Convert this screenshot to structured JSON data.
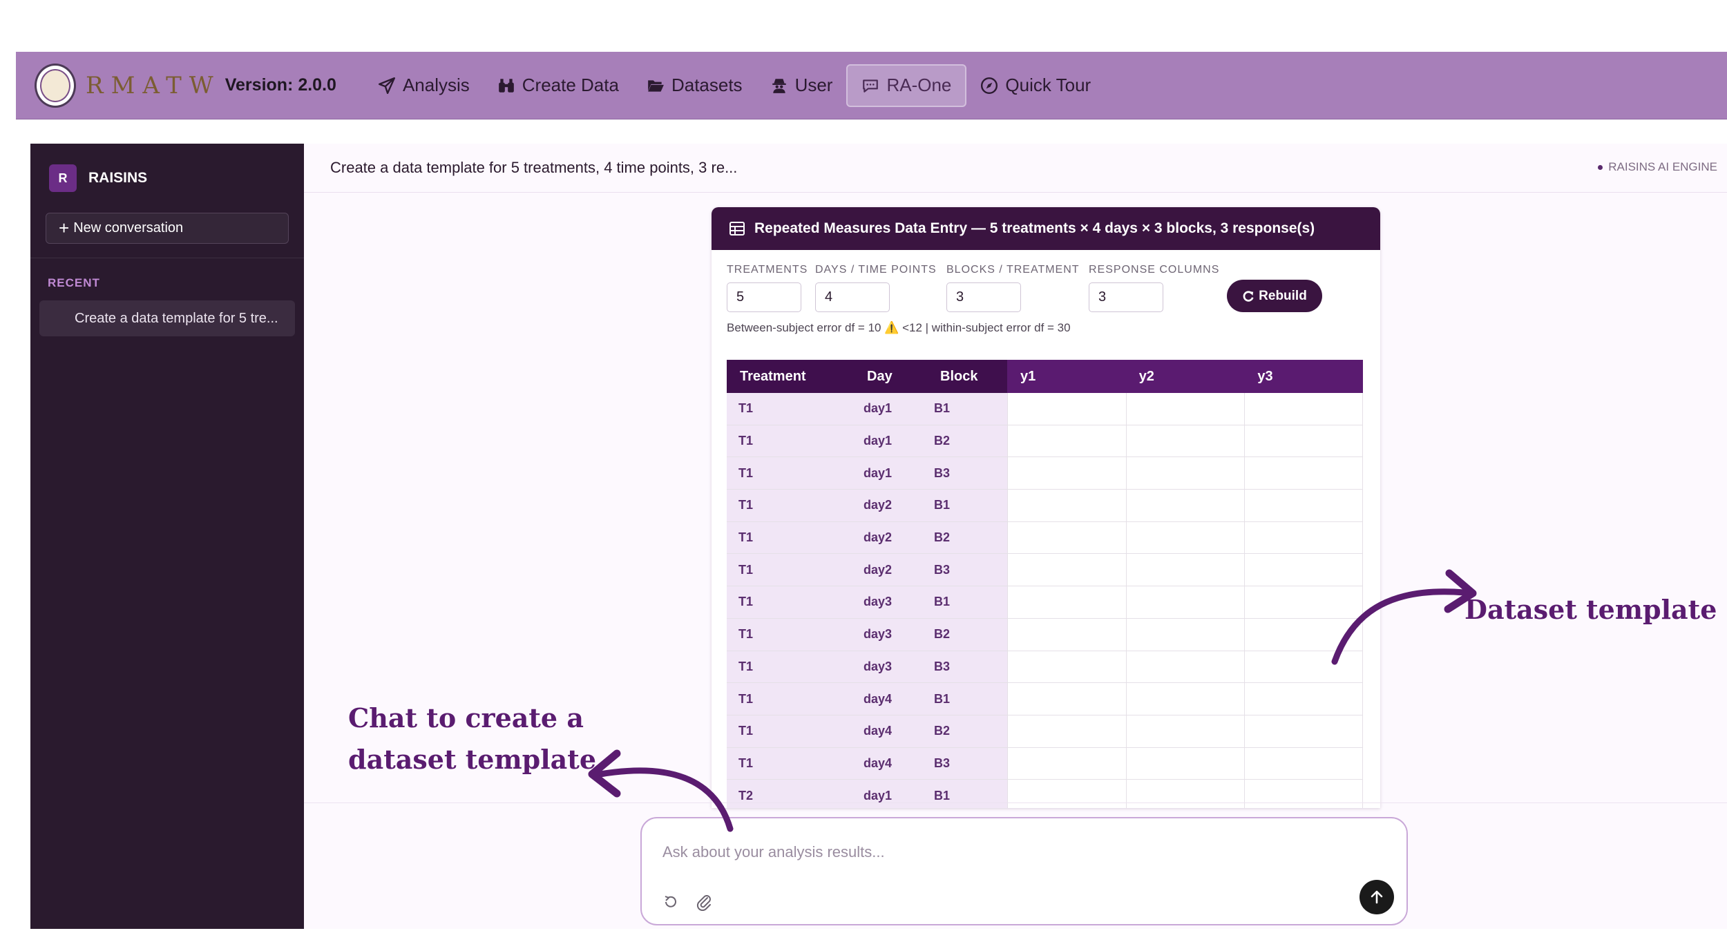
{
  "nav": {
    "brand": "RMATW",
    "version": "Version: 2.0.0",
    "items": [
      {
        "label": "Analysis",
        "icon": "paper-plane-icon"
      },
      {
        "label": "Create Data",
        "icon": "binoculars-icon"
      },
      {
        "label": "Datasets",
        "icon": "folder-open-icon"
      },
      {
        "label": "User",
        "icon": "user-secret-icon"
      },
      {
        "label": "RA-One",
        "icon": "chat-icon",
        "active": true
      },
      {
        "label": "Quick Tour",
        "icon": "compass-icon"
      }
    ]
  },
  "sidebar": {
    "avatar": "R",
    "title": "RAISINS",
    "new_conversation": "New conversation",
    "recent_label": "RECENT",
    "conversations": [
      "Create a data template for 5 tre..."
    ]
  },
  "main": {
    "conversation_title": "Create a data template for 5 treatments, 4 time points, 3 re...",
    "engine_label": "RAISINS AI ENGINE"
  },
  "card": {
    "title": "Repeated Measures Data Entry — 5 treatments × 4 days × 3 blocks, 3 response(s)",
    "params": [
      {
        "label": "TREATMENTS",
        "value": "5"
      },
      {
        "label": "DAYS / TIME POINTS",
        "value": "4"
      },
      {
        "label": "BLOCKS / TREATMENT",
        "value": "3"
      },
      {
        "label": "RESPONSE COLUMNS",
        "value": "3"
      }
    ],
    "rebuild_label": "Rebuild",
    "df_note": "Between-subject error df = 10 ⚠️ <12 | within-subject error df = 30",
    "table": {
      "columns": [
        "Treatment",
        "Day",
        "Block",
        "y1",
        "y2",
        "y3"
      ],
      "rows": [
        [
          "T1",
          "day1",
          "B1"
        ],
        [
          "T1",
          "day1",
          "B2"
        ],
        [
          "T1",
          "day1",
          "B3"
        ],
        [
          "T1",
          "day2",
          "B1"
        ],
        [
          "T1",
          "day2",
          "B2"
        ],
        [
          "T1",
          "day2",
          "B3"
        ],
        [
          "T1",
          "day3",
          "B1"
        ],
        [
          "T1",
          "day3",
          "B2"
        ],
        [
          "T1",
          "day3",
          "B3"
        ],
        [
          "T1",
          "day4",
          "B1"
        ],
        [
          "T1",
          "day4",
          "B2"
        ],
        [
          "T1",
          "day4",
          "B3"
        ],
        [
          "T2",
          "day1",
          "B1"
        ]
      ]
    }
  },
  "chat": {
    "placeholder": "Ask about your analysis results..."
  },
  "annotations": {
    "dataset_template": "Dataset template",
    "chat_line1": "Chat to create a",
    "chat_line2": "dataset template"
  },
  "colors": {
    "navbar": "#a77fb9",
    "sidebar": "#2a1a2e",
    "accent": "#3a1440",
    "annotation": "#5a1c70"
  }
}
